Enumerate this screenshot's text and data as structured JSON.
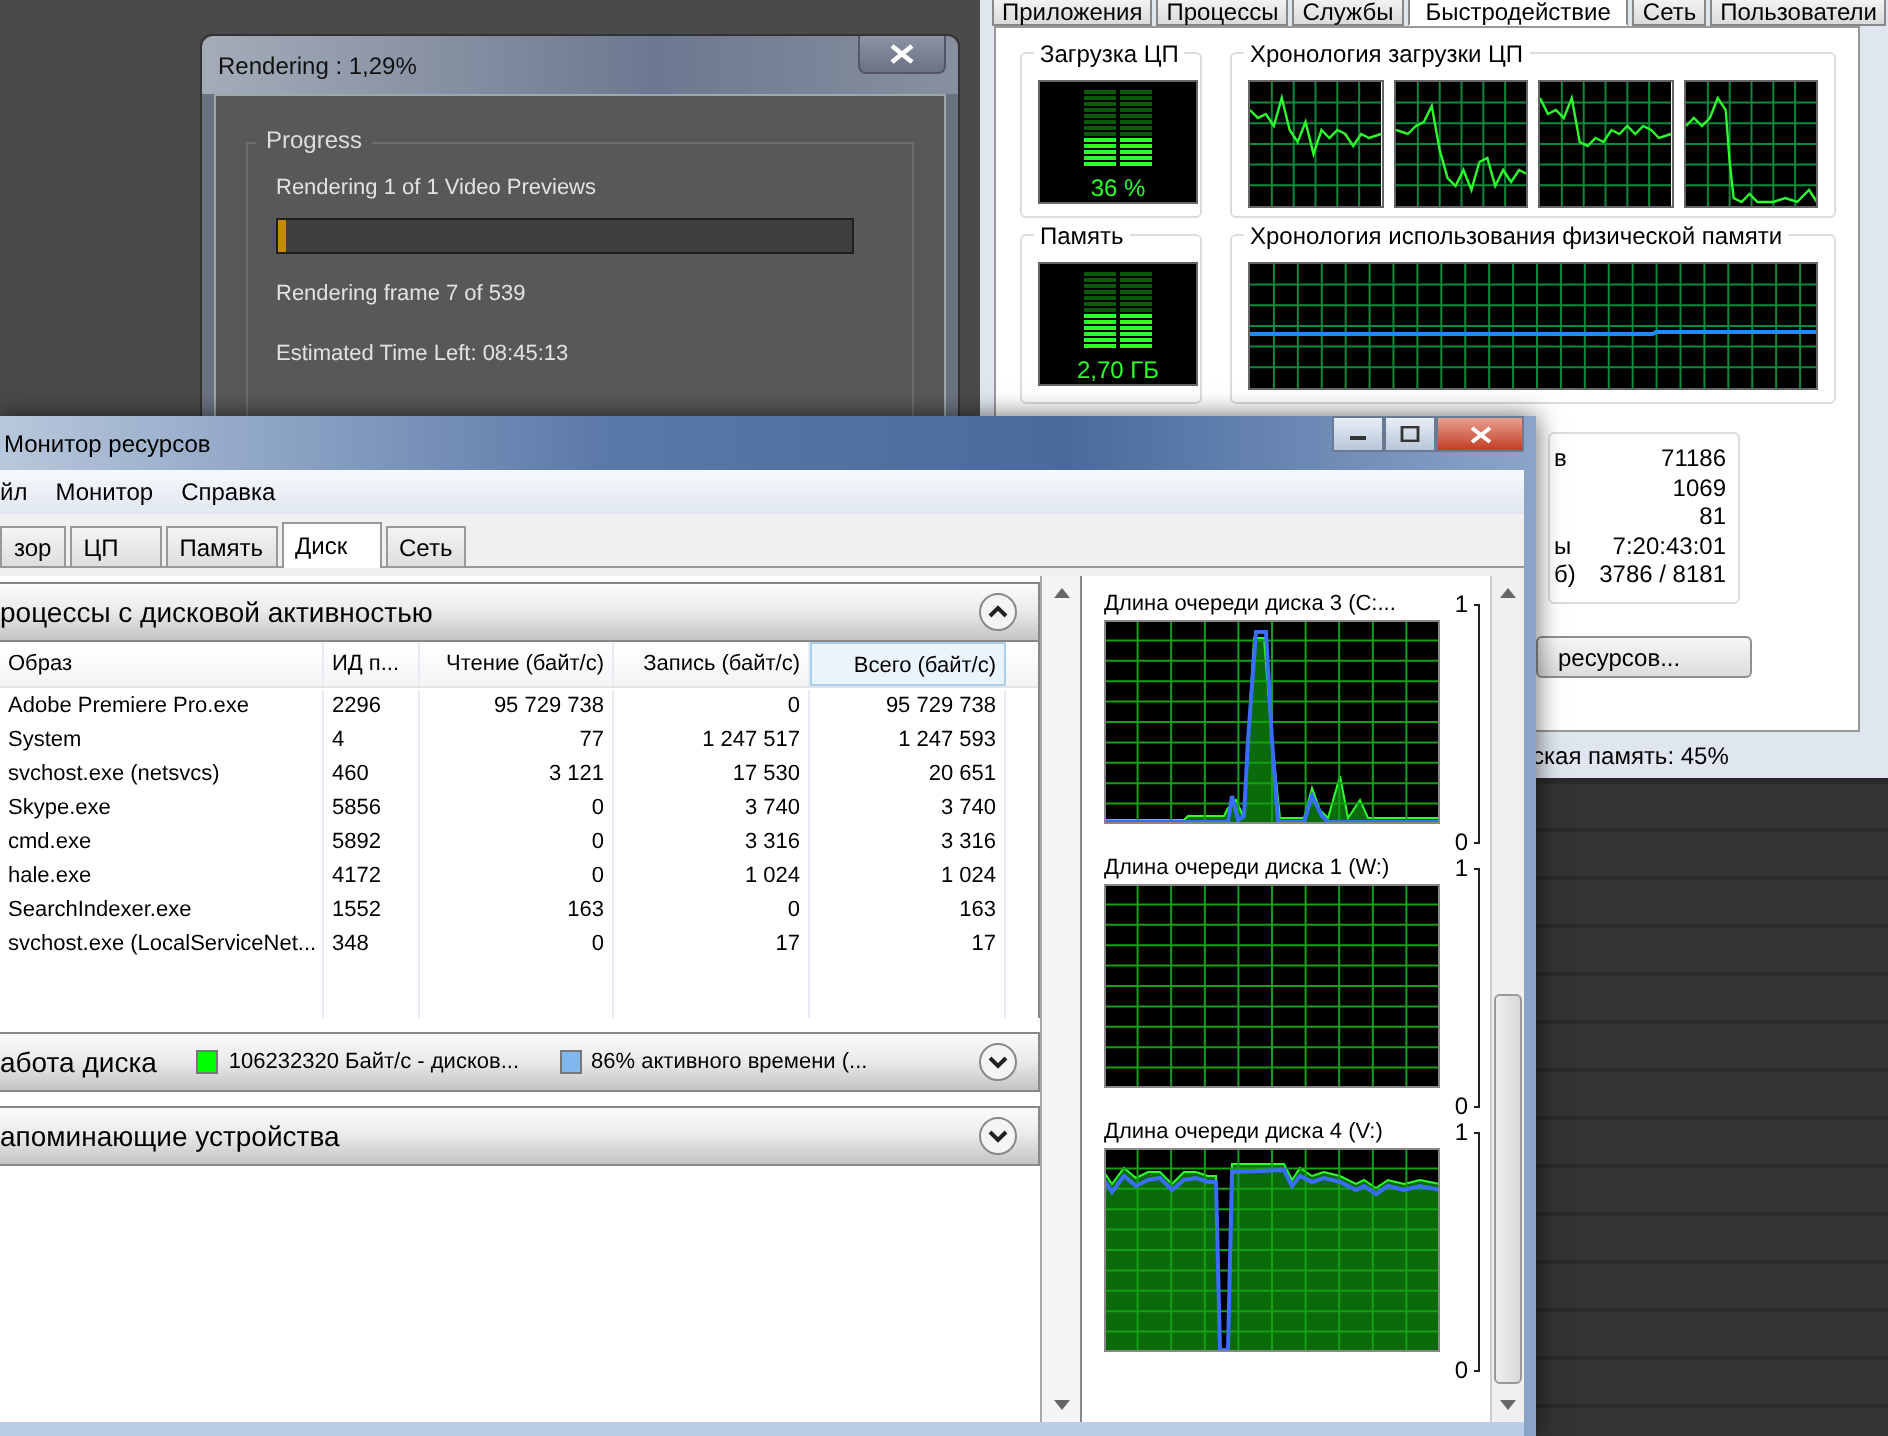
{
  "render_dialog": {
    "title": "Rendering : 1,29%",
    "group": "Progress",
    "status": "Rendering 1 of 1 Video Previews",
    "level": 0.0129,
    "frame": "Rendering frame 7 of 539",
    "time_left": "Estimated Time Left: 08:45:13"
  },
  "task_manager": {
    "tabs": [
      {
        "label": "Приложения",
        "selected": false
      },
      {
        "label": "Процессы",
        "selected": false
      },
      {
        "label": "Службы",
        "selected": false
      },
      {
        "label": "Быстродействие",
        "selected": true
      },
      {
        "label": "Сеть",
        "selected": false
      },
      {
        "label": "Пользователи",
        "selected": false
      }
    ],
    "cpu": {
      "label": "Загрузка ЦП",
      "reading": "36 %",
      "level": 0.36
    },
    "cpu_history": {
      "label": "Хронология загрузки ЦП"
    },
    "memory": {
      "label": "Память",
      "reading": "2,70 ГБ",
      "level": 0.45
    },
    "memory_history": {
      "label": "Хронология использования физической памяти"
    },
    "stats": [
      {
        "label": "в",
        "value": "71186"
      },
      {
        "value": "1069"
      },
      {
        "value": "81"
      },
      {
        "label": "ы",
        "value": "7:20:43:01"
      },
      {
        "label": "б)",
        "value": "3786 / 8181"
      }
    ],
    "resource_button": "ресурсов...",
    "status_bar": "ская память: 45%"
  },
  "resource_monitor": {
    "title": "Монитор ресурсов",
    "menu": [
      "йл",
      "Монитор",
      "Справка"
    ],
    "tabs": [
      {
        "label": "зор",
        "selected": false
      },
      {
        "label": "ЦП",
        "selected": false
      },
      {
        "label": "Память",
        "selected": false
      },
      {
        "label": "Диск",
        "selected": true
      },
      {
        "label": "Сеть",
        "selected": false
      }
    ],
    "processes": {
      "title": "роцессы с дисковой активностью",
      "expanded": true,
      "columns": [
        {
          "label": "Образ",
          "sorted": false
        },
        {
          "label": "ИД п...",
          "sorted": false
        },
        {
          "label": "Чтение (байт/с)",
          "sorted": false
        },
        {
          "label": "Запись (байт/с)",
          "sorted": false
        },
        {
          "label": "Всего (байт/с)",
          "sorted": true
        }
      ],
      "rows": [
        [
          "Adobe Premiere Pro.exe",
          "2296",
          "95 729 738",
          "0",
          "95 729 738"
        ],
        [
          "System",
          "4",
          "77",
          "1 247 517",
          "1 247 593"
        ],
        [
          "svchost.exe (netsvcs)",
          "460",
          "3 121",
          "17 530",
          "20 651"
        ],
        [
          "Skype.exe",
          "5856",
          "0",
          "3 740",
          "3 740"
        ],
        [
          "cmd.exe",
          "5892",
          "0",
          "3 316",
          "3 316"
        ],
        [
          "hale.exe",
          "4172",
          "0",
          "1 024",
          "1 024"
        ],
        [
          "SearchIndexer.exe",
          "1552",
          "163",
          "0",
          "163"
        ],
        [
          "svchost.exe (LocalServiceNet...",
          "348",
          "0",
          "17",
          "17"
        ]
      ]
    },
    "disk_activity": {
      "title": "абота диска",
      "expanded": false,
      "legend": [
        {
          "label": "106232320 Байт/с - дисков...",
          "color": "#00ff00"
        },
        {
          "label": "86% активного времени (...",
          "color": "#7fb7ee"
        }
      ]
    },
    "storage": {
      "title": "апоминающие устройства",
      "expanded": false
    },
    "graphs": [
      {
        "title": "Длина очереди диска 3 (C:...",
        "max": "1",
        "min": "0"
      },
      {
        "title": "Длина очереди диска 1 (W:)",
        "max": "1",
        "min": "0"
      },
      {
        "title": "Длина очереди диска 4 (V:)",
        "max": "1",
        "min": "0"
      }
    ]
  }
}
